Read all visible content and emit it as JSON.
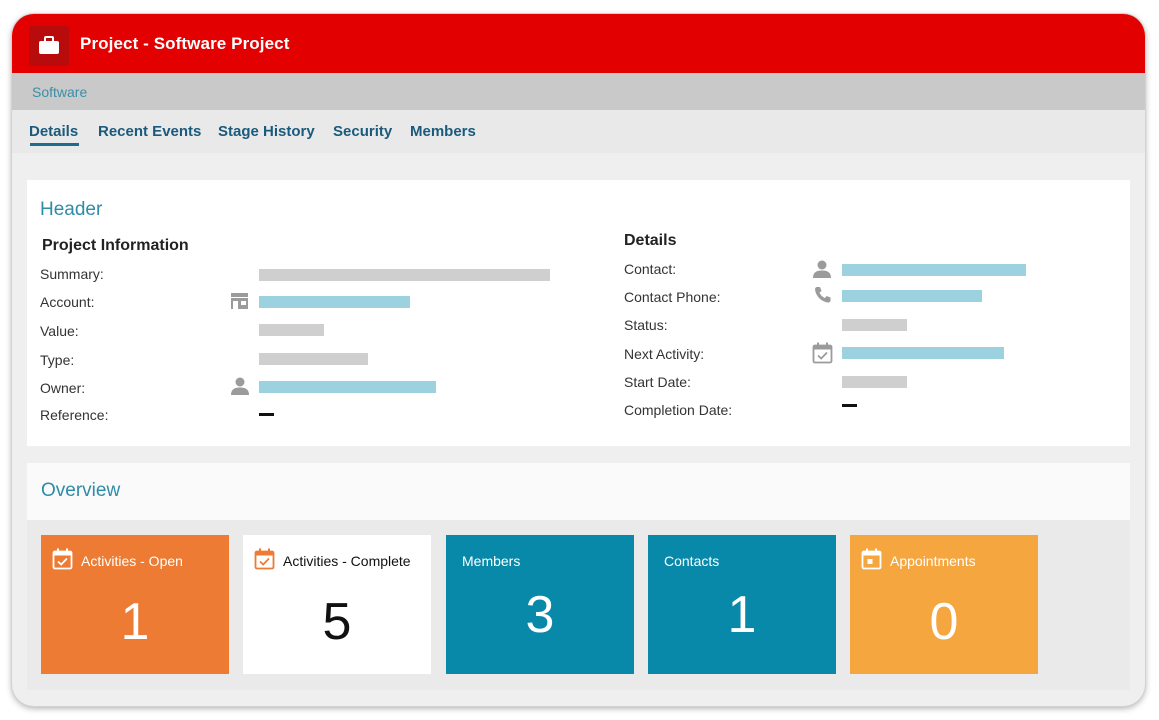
{
  "app": {
    "title": "Project - Software Project",
    "title_icon": "briefcase-icon",
    "brand_color": "#e20000"
  },
  "breadcrumb": {
    "label": "Software"
  },
  "tabs": [
    {
      "label": "Details",
      "active": true
    },
    {
      "label": "Recent Events",
      "active": false
    },
    {
      "label": "Stage History",
      "active": false
    },
    {
      "label": "Security",
      "active": false
    },
    {
      "label": "Members",
      "active": false
    }
  ],
  "header_section": {
    "title": "Header",
    "project_info": {
      "heading": "Project Information",
      "fields": [
        {
          "label": "Summary:",
          "icon": "",
          "value_style": "gray-bar"
        },
        {
          "label": "Account:",
          "icon": "store-icon",
          "value_style": "blue-link-bar"
        },
        {
          "label": "Value:",
          "icon": "",
          "value_style": "gray-bar"
        },
        {
          "label": "Type:",
          "icon": "",
          "value_style": "gray-bar"
        },
        {
          "label": "Owner:",
          "icon": "person-icon",
          "value_style": "blue-link-bar"
        },
        {
          "label": "Reference:",
          "icon": "",
          "value_style": "dash"
        }
      ]
    },
    "details": {
      "heading": "Details",
      "fields": [
        {
          "label": "Contact:",
          "icon": "person-icon",
          "value_style": "blue-link-bar"
        },
        {
          "label": "Contact Phone:",
          "icon": "phone-icon",
          "value_style": "blue-link-bar"
        },
        {
          "label": "Status:",
          "icon": "",
          "value_style": "gray-bar"
        },
        {
          "label": "Next Activity:",
          "icon": "calendar-check-icon",
          "value_style": "blue-link-bar"
        },
        {
          "label": "Start Date:",
          "icon": "",
          "value_style": "gray-bar"
        },
        {
          "label": "Completion Date:",
          "icon": "",
          "value_style": "dash"
        }
      ]
    }
  },
  "overview": {
    "title": "Overview",
    "tiles": [
      {
        "label": "Activities - Open",
        "value": "1",
        "icon": "calendar-check-icon",
        "color": "#ed7b33"
      },
      {
        "label": "Activities - Complete",
        "value": "5",
        "icon": "calendar-check-icon",
        "color": "#ffffff"
      },
      {
        "label": "Members",
        "value": "3",
        "icon": "",
        "color": "#0889a9"
      },
      {
        "label": "Contacts",
        "value": "1",
        "icon": "",
        "color": "#0889a9"
      },
      {
        "label": "Appointments",
        "value": "0",
        "icon": "calendar-icon",
        "color": "#f5a63f"
      }
    ]
  }
}
